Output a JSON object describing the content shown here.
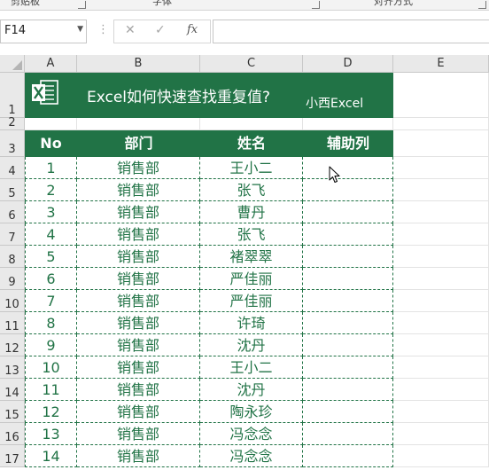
{
  "ribbon": {
    "groups": [
      "剪贴板",
      "字体",
      "对齐方式"
    ]
  },
  "formula_bar": {
    "name_box": "F14",
    "cancel_icon": "close-icon",
    "enter_icon": "check-icon",
    "fx_label": "fx",
    "formula": ""
  },
  "grid": {
    "columns": [
      "A",
      "B",
      "C",
      "D",
      "E"
    ],
    "rows": [
      "1",
      "2",
      "3",
      "4",
      "5",
      "6",
      "7",
      "8",
      "9",
      "10",
      "11",
      "12",
      "13",
      "14",
      "15",
      "16",
      "17"
    ]
  },
  "banner": {
    "title": "Excel如何快速查找重复值?",
    "author": "小西Excel",
    "brand_color": "#217346"
  },
  "table": {
    "headers": [
      "No",
      "部门",
      "姓名",
      "辅助列"
    ],
    "rows": [
      {
        "no": "1",
        "dept": "销售部",
        "name": "王小二",
        "helper": ""
      },
      {
        "no": "2",
        "dept": "销售部",
        "name": "张飞",
        "helper": ""
      },
      {
        "no": "3",
        "dept": "销售部",
        "name": "曹丹",
        "helper": ""
      },
      {
        "no": "4",
        "dept": "销售部",
        "name": "张飞",
        "helper": ""
      },
      {
        "no": "5",
        "dept": "销售部",
        "name": "褚翠翠",
        "helper": ""
      },
      {
        "no": "6",
        "dept": "销售部",
        "name": "严佳丽",
        "helper": ""
      },
      {
        "no": "7",
        "dept": "销售部",
        "name": "严佳丽",
        "helper": ""
      },
      {
        "no": "8",
        "dept": "销售部",
        "name": "许琦",
        "helper": ""
      },
      {
        "no": "9",
        "dept": "销售部",
        "name": "沈丹",
        "helper": ""
      },
      {
        "no": "10",
        "dept": "销售部",
        "name": "王小二",
        "helper": ""
      },
      {
        "no": "11",
        "dept": "销售部",
        "name": "沈丹",
        "helper": ""
      },
      {
        "no": "12",
        "dept": "销售部",
        "name": "陶永珍",
        "helper": ""
      },
      {
        "no": "13",
        "dept": "销售部",
        "name": "冯念念",
        "helper": ""
      },
      {
        "no": "14",
        "dept": "销售部",
        "name": "冯念念",
        "helper": ""
      }
    ]
  },
  "cursor": "arrow-cursor-icon"
}
